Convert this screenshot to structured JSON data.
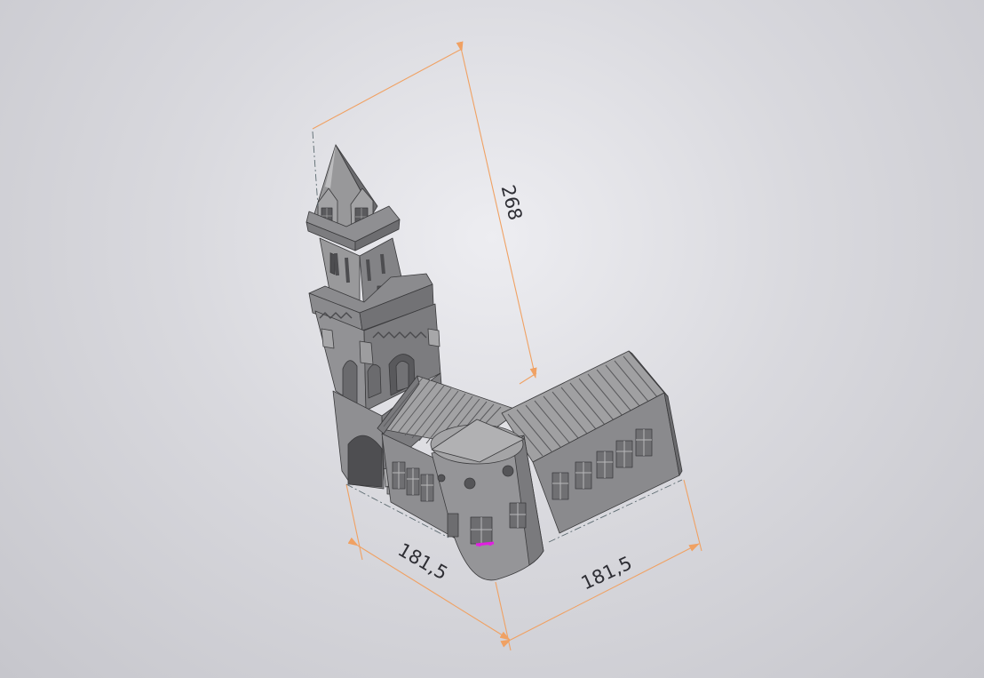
{
  "viewport": {
    "background": "#d6d6db"
  },
  "model": {
    "color": "#8c8c8e",
    "dark_color": "#5f5f62",
    "light_color": "#b4b4b6"
  },
  "dimensions": {
    "color": "#f0a163",
    "height": "268",
    "width_left": "181,5",
    "width_right": "181,5"
  },
  "selection": {
    "color": "#e020e0"
  }
}
